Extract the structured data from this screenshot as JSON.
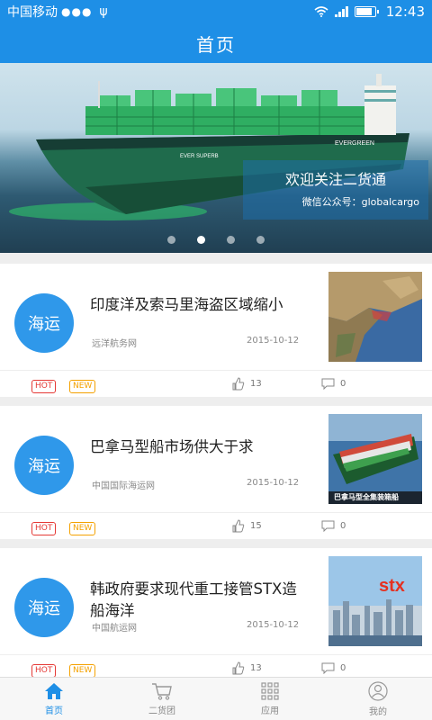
{
  "status_bar": {
    "carrier": "中国移动",
    "time": "12:43"
  },
  "header": {
    "title": "首页"
  },
  "banner": {
    "caption_title": "欢迎关注二货通",
    "caption_sub": "微信公众号：globalcargo",
    "ship_label_1": "EVERGREEN",
    "ship_label_2": "EVER SUPERB",
    "slide_count": 4,
    "active_slide": 2
  },
  "articles": [
    {
      "badge": "海运",
      "title": "印度洋及索马里海盗区域缩小",
      "source": "远洋航务网",
      "date": "2015-10-12",
      "hot": "HOT",
      "new": "NEW",
      "likes": "13",
      "comments": "0"
    },
    {
      "badge": "海运",
      "title": "巴拿马型船市场供大于求",
      "source": "中国国际海运网",
      "date": "2015-10-12",
      "hot": "HOT",
      "new": "NEW",
      "likes": "15",
      "comments": "0",
      "thumb_caption": "巴拿马型全集装箱船"
    },
    {
      "badge": "海运",
      "title": "韩政府要求现代重工接管STX造船海洋",
      "source": "中国航运网",
      "date": "2015-10-12",
      "hot": "HOT",
      "new": "NEW",
      "likes": "13",
      "comments": "0",
      "thumb_logo": "stx"
    }
  ],
  "bottom_nav": [
    {
      "label": "首页",
      "icon": "home-icon",
      "active": true
    },
    {
      "label": "二货团",
      "icon": "cart-icon",
      "active": false
    },
    {
      "label": "应用",
      "icon": "grid-icon",
      "active": false
    },
    {
      "label": "我的",
      "icon": "user-icon",
      "active": false
    }
  ],
  "colors": {
    "primary": "#1e8fe6",
    "hot": "#e53935",
    "new": "#f4a100"
  }
}
